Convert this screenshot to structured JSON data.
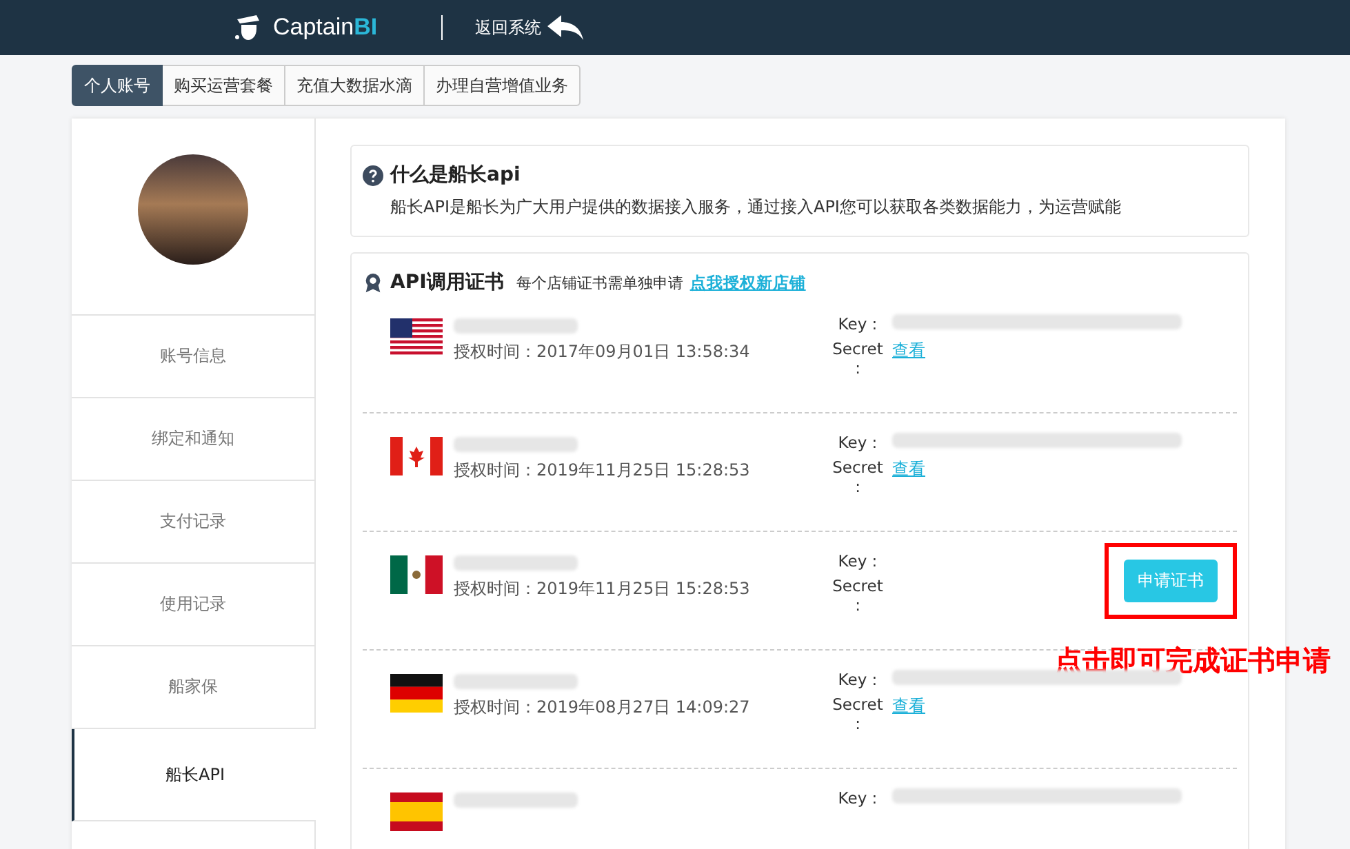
{
  "header": {
    "logo_text": "Captain",
    "logo_accent": "BI",
    "back_link": "返回系统"
  },
  "tabs": [
    {
      "label": "个人账号",
      "selected": true
    },
    {
      "label": "购买运营套餐",
      "selected": false
    },
    {
      "label": "充值大数据水滴",
      "selected": false
    },
    {
      "label": "办理自营增值业务",
      "selected": false
    }
  ],
  "sidebar": {
    "items": [
      {
        "label": "账号信息",
        "selected": false
      },
      {
        "label": "绑定和通知",
        "selected": false
      },
      {
        "label": "支付记录",
        "selected": false
      },
      {
        "label": "使用记录",
        "selected": false
      },
      {
        "label": "船家保",
        "selected": false
      },
      {
        "label": "船长API",
        "selected": true
      }
    ]
  },
  "intro": {
    "title": "什么是船长api",
    "text": "船长API是船长为广大用户提供的数据接入服务，通过接入API您可以获取各类数据能力，为运营赋能"
  },
  "certificates": {
    "title": "API调用证书",
    "note": "每个店铺证书需单独申请",
    "link": "点我授权新店铺",
    "items": [
      {
        "kind": "us",
        "time": "授权时间：2017年09月01日 13:58:34",
        "key_label": "Key :",
        "secret_label": "Secret :",
        "view_link": "查看"
      },
      {
        "kind": "ca",
        "time": "授权时间：2019年11月25日 15:28:53",
        "key_label": "Key :",
        "secret_label": "Secret :",
        "view_link": "查看"
      },
      {
        "kind": "mx",
        "time": "授权时间：2019年11月25日 15:28:53",
        "key_label": "Key :",
        "secret_label": "Secret :",
        "button": "申请证书"
      },
      {
        "kind": "de",
        "time": "授权时间：2019年08月27日 14:09:27",
        "key_label": "Key :",
        "secret_label": "Secret :",
        "view_link": "查看"
      },
      {
        "kind": "es",
        "key_label": "Key :"
      }
    ]
  },
  "annotation": {
    "text": "点击即可完成证书申请"
  }
}
